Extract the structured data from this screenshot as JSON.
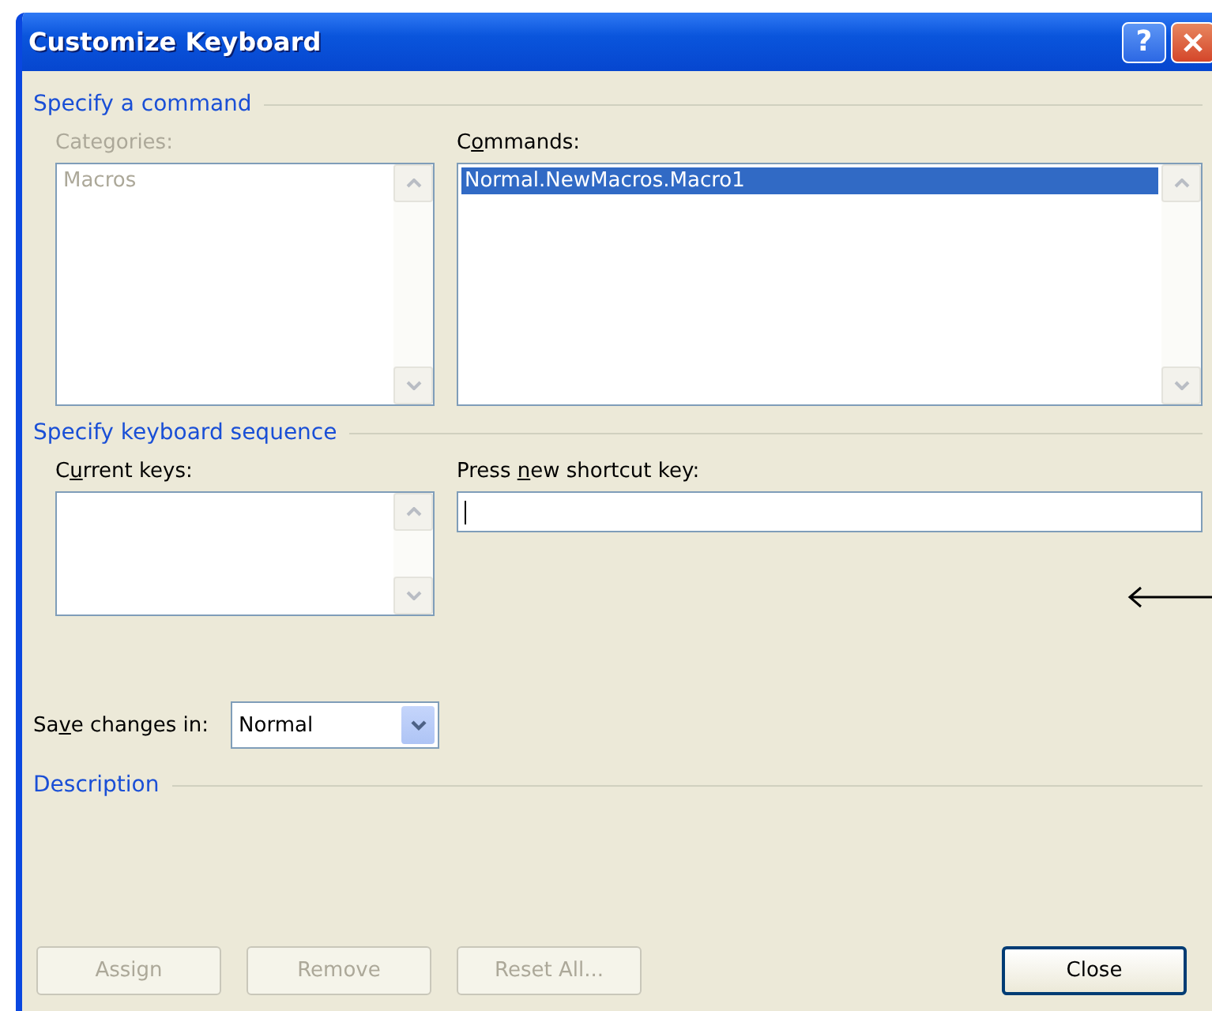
{
  "window": {
    "title": "Customize Keyboard",
    "help_button": "?"
  },
  "sections": [
    {
      "title": "Specify a command"
    },
    {
      "title": "Specify keyboard sequence"
    },
    {
      "title": "Description"
    }
  ],
  "categories": {
    "label": {
      "before": "Categories:"
    },
    "disabled": true,
    "items": [
      {
        "text": "Macros",
        "selected": false
      }
    ]
  },
  "commands": {
    "label": {
      "before": "C",
      "key": "o",
      "after": "mmands:"
    },
    "items": [
      {
        "text": "Normal.NewMacros.Macro1",
        "selected": true
      }
    ]
  },
  "current_keys": {
    "label": {
      "before": "C",
      "key": "u",
      "after": "rrent keys:"
    }
  },
  "new_shortcut": {
    "label": {
      "before": "Press ",
      "key": "n",
      "after": "ew shortcut key:"
    },
    "focused": true
  },
  "save_changes": {
    "label": {
      "before": "Sa",
      "key": "v",
      "after": "e changes in:"
    },
    "value": "Normal"
  },
  "buttons": [
    {
      "label": "Assign",
      "disabled": true,
      "default": false
    },
    {
      "label": "Remove",
      "disabled": true,
      "default": false
    },
    {
      "label": "Reset All...",
      "disabled": true,
      "default": false
    },
    {
      "label": "Close",
      "disabled": false,
      "default": true
    }
  ]
}
